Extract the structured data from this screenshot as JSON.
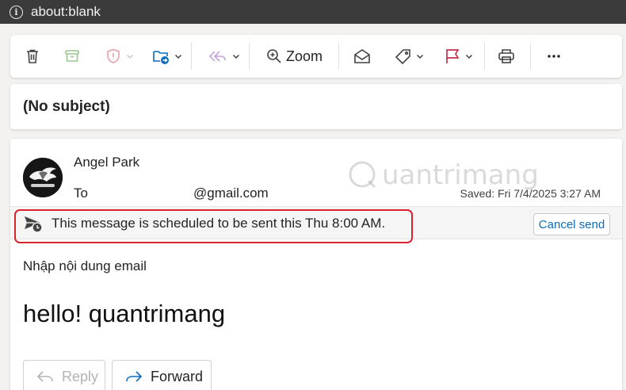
{
  "browser": {
    "url": "about:blank"
  },
  "toolbar": {
    "zoom_label": "Zoom",
    "icons": [
      "delete-icon",
      "archive-icon",
      "report-icon",
      "move-to-folder-icon",
      "reply-all-icon",
      "zoom-icon",
      "mark-read-icon",
      "tag-icon",
      "flag-icon",
      "print-icon",
      "more-icon"
    ]
  },
  "message": {
    "subject": "(No subject)",
    "sender_name": "Angel Park",
    "to_label": "To",
    "to_email": "@gmail.com",
    "saved": "Saved: Fri 7/4/2025 3:27 AM",
    "schedule_notice": "This message is scheduled to be sent this Thu 8:00 AM.",
    "cancel_send_label": "Cancel send",
    "body_line1": "Nhập nội dung email",
    "body_line2": "hello! quantrimang",
    "reply_label": "Reply",
    "forward_label": "Forward"
  },
  "watermark": {
    "text": "uantrimang"
  },
  "colors": {
    "accent": "#0f6cbd",
    "highlight": "#d9232f",
    "flag": "#c4314b",
    "disabled": "#b3b3b3"
  }
}
